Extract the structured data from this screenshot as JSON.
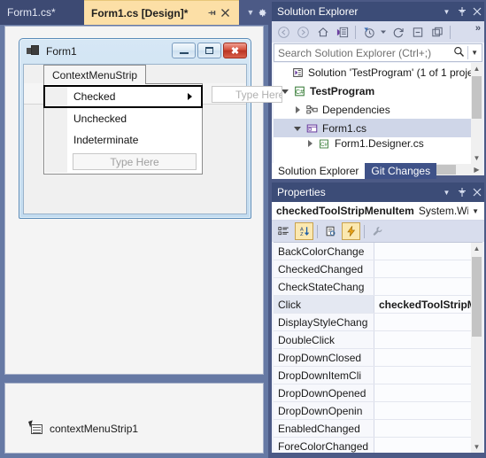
{
  "editor": {
    "tabs": [
      {
        "label": "Form1.cs*",
        "active": false
      },
      {
        "label": "Form1.cs [Design]*",
        "active": true
      }
    ],
    "tab_pin_icon": "pin-icon",
    "tab_close_icon": "close-icon",
    "tab_overflow_icon": "chevron-down-icon",
    "tab_settings_icon": "gear-icon"
  },
  "designer": {
    "form": {
      "title": "Form1",
      "app_icon": "form-app-icon",
      "minimize_label": "Minimize",
      "maximize_label": "Maximize",
      "close_label": "Close"
    },
    "context_menu_strip": {
      "tab_label": "ContextMenuStrip",
      "items": [
        {
          "label": "Checked",
          "selected": true,
          "has_submenu": true
        },
        {
          "label": "Unchecked",
          "selected": false,
          "has_submenu": false
        },
        {
          "label": "Indeterminate",
          "selected": false,
          "has_submenu": false
        }
      ],
      "type_here_placeholder": "Type Here",
      "top_level_type_here": "Type Here"
    },
    "tray": {
      "component_name": "contextMenuStrip1",
      "component_icon": "context-menu-strip-icon"
    }
  },
  "solution_explorer": {
    "title": "Solution Explorer",
    "header_buttons": [
      {
        "name": "dropdown-icon",
        "glyph": "▼"
      },
      {
        "name": "pin-icon",
        "glyph": "⚐"
      },
      {
        "name": "close-icon",
        "glyph": "✕"
      }
    ],
    "toolbar": [
      {
        "name": "back-icon",
        "glyph": "←"
      },
      {
        "name": "forward-icon",
        "glyph": "→"
      },
      {
        "name": "home-icon",
        "glyph": "⌂"
      },
      {
        "name": "solution-explorer-view-icon",
        "glyph": "▤"
      },
      {
        "name": "pending-changes-filter-icon",
        "glyph": "◔"
      },
      {
        "name": "filter-dropdown-icon",
        "glyph": "▾"
      },
      {
        "name": "refresh-icon",
        "glyph": "↻"
      },
      {
        "name": "collapse-all-icon",
        "glyph": "⊟"
      },
      {
        "name": "show-all-files-icon",
        "glyph": "❐"
      }
    ],
    "toolbar_overflow": "»",
    "search": {
      "placeholder": "Search Solution Explorer (Ctrl+;)",
      "value": "",
      "search_icon": "search-icon",
      "dropdown_icon": "chevron-down-icon"
    },
    "tree": [
      {
        "label": "Solution 'TestProgram' (1 of 1 proje",
        "indent": 0,
        "expander": "none",
        "icon": "solution-icon",
        "bold": false,
        "selected": false
      },
      {
        "label": "TestProgram",
        "indent": 1,
        "expander": "expanded",
        "icon": "csharp-project-icon",
        "bold": true,
        "selected": false
      },
      {
        "label": "Dependencies",
        "indent": 2,
        "expander": "collapsed",
        "icon": "dependencies-icon",
        "bold": false,
        "selected": false
      },
      {
        "label": "Form1.cs",
        "indent": 2,
        "expander": "expanded",
        "icon": "form-file-icon",
        "bold": false,
        "selected": true
      },
      {
        "label": "Form1.Designer.cs",
        "indent": 3,
        "expander": "collapsed",
        "icon": "csharp-file-icon",
        "bold": false,
        "selected": false
      }
    ],
    "dock_tabs": [
      {
        "label": "Solution Explorer",
        "active": true
      },
      {
        "label": "Git Changes",
        "active": false
      }
    ]
  },
  "properties": {
    "title": "Properties",
    "header_buttons": [
      {
        "name": "dropdown-icon",
        "glyph": "▼"
      },
      {
        "name": "pin-icon",
        "glyph": "⚐"
      },
      {
        "name": "close-icon",
        "glyph": "✕"
      }
    ],
    "object_name": "checkedToolStripMenuItem",
    "object_type": "System.Wi",
    "object_dropdown_icon": "chevron-down-icon",
    "toolbar": [
      {
        "name": "categorized-button",
        "glyph": "☷",
        "pressed": false
      },
      {
        "name": "alphabetical-button",
        "glyph": "A↓",
        "pressed": true
      },
      {
        "name": "properties-button",
        "glyph": "⛭",
        "pressed": false
      },
      {
        "name": "events-button",
        "glyph": "⚡",
        "pressed": true
      },
      {
        "name": "property-pages-button",
        "glyph": "⚒",
        "pressed": false
      }
    ],
    "rows": [
      {
        "name": "BackColorChange",
        "value": "",
        "selected": false
      },
      {
        "name": "CheckedChanged",
        "value": "",
        "selected": false
      },
      {
        "name": "CheckStateChang",
        "value": "",
        "selected": false
      },
      {
        "name": "Click",
        "value": "checkedToolStripM",
        "selected": true
      },
      {
        "name": "DisplayStyleChang",
        "value": "",
        "selected": false
      },
      {
        "name": "DoubleClick",
        "value": "",
        "selected": false
      },
      {
        "name": "DropDownClosed",
        "value": "",
        "selected": false
      },
      {
        "name": "DropDownItemCli",
        "value": "",
        "selected": false
      },
      {
        "name": "DropDownOpened",
        "value": "",
        "selected": false
      },
      {
        "name": "DropDownOpenin",
        "value": "",
        "selected": false
      },
      {
        "name": "EnabledChanged",
        "value": "",
        "selected": false
      },
      {
        "name": "ForeColorChanged",
        "value": "",
        "selected": false
      }
    ]
  },
  "colors": {
    "chrome": "#4c5a86",
    "tab_active_bg": "#fcdfa6",
    "tab_inactive_bg": "#3d4a73",
    "tool_window_header": "#3c4c77",
    "selection": "#cfd6e8",
    "toolbar_bg": "#d8dded",
    "pressed_button": "#fbe8b0"
  }
}
